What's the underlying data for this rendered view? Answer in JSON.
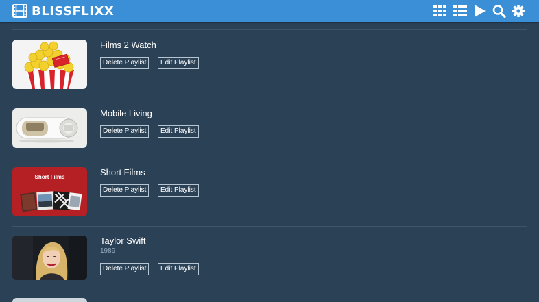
{
  "app": {
    "title": "BLISSFLIXX",
    "logo_icon": "film-icon",
    "brand_color": "#3a8fd6",
    "background_color": "#2b4156"
  },
  "toolbar": {
    "icons": [
      "grid-view-icon",
      "list-view-icon",
      "play-icon",
      "search-icon",
      "gear-icon"
    ]
  },
  "playlists": [
    {
      "title": "Films 2 Watch",
      "subtitle": "",
      "thumbnail": "popcorn-image",
      "delete_label": "Delete Playlist",
      "edit_label": "Edit Playlist"
    },
    {
      "title": "Mobile Living",
      "subtitle": "",
      "thumbnail": "capsule-trailer-image",
      "delete_label": "Delete Playlist",
      "edit_label": "Edit Playlist"
    },
    {
      "title": "Short Films",
      "subtitle": "",
      "thumbnail": "short-films-poster",
      "thumbnail_text": "Short Films",
      "delete_label": "Delete Playlist",
      "edit_label": "Edit Playlist"
    },
    {
      "title": "Taylor Swift",
      "subtitle": "1989",
      "thumbnail": "artist-portrait-image",
      "delete_label": "Delete Playlist",
      "edit_label": "Edit Playlist"
    }
  ]
}
